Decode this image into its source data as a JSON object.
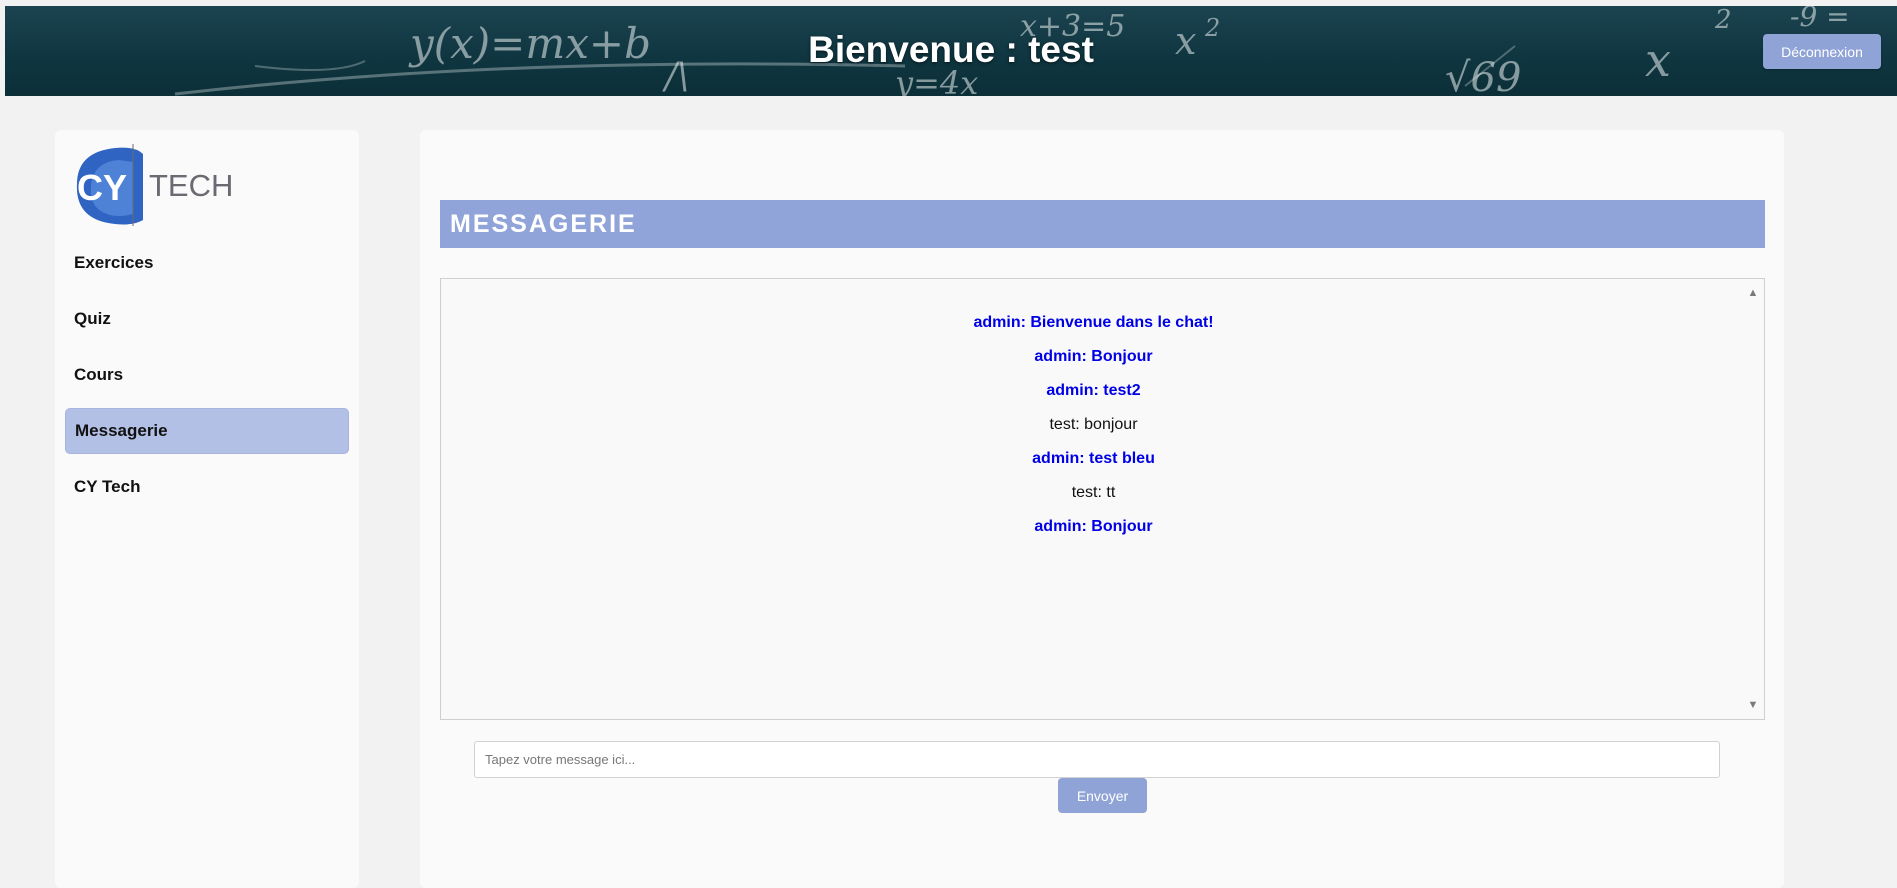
{
  "header": {
    "title": "Bienvenue : test",
    "logout_label": "Déconnexion"
  },
  "sidebar": {
    "logo_text": "TECH",
    "logo_monogram": "CY",
    "items": [
      {
        "label": "Exercices",
        "active": false
      },
      {
        "label": "Quiz",
        "active": false
      },
      {
        "label": "Cours",
        "active": false
      },
      {
        "label": "Messagerie",
        "active": true
      },
      {
        "label": "CY Tech",
        "active": false
      }
    ]
  },
  "main": {
    "section_title": "MESSAGERIE",
    "messages": [
      {
        "text": "admin: Bienvenue dans le chat!",
        "author": "admin"
      },
      {
        "text": "admin: Bonjour",
        "author": "admin"
      },
      {
        "text": "admin: test2",
        "author": "admin"
      },
      {
        "text": "test: bonjour",
        "author": "test"
      },
      {
        "text": "admin: test bleu",
        "author": "admin"
      },
      {
        "text": "test: tt",
        "author": "test"
      },
      {
        "text": "admin: Bonjour",
        "author": "admin"
      }
    ],
    "input_placeholder": "Tapez votre message ici...",
    "input_value": "",
    "send_label": "Envoyer"
  },
  "colors": {
    "accent": "#91a4d9",
    "nav_active": "#b3c0e6",
    "admin_message": "#0000e6",
    "header_bg": "#0f3641"
  }
}
